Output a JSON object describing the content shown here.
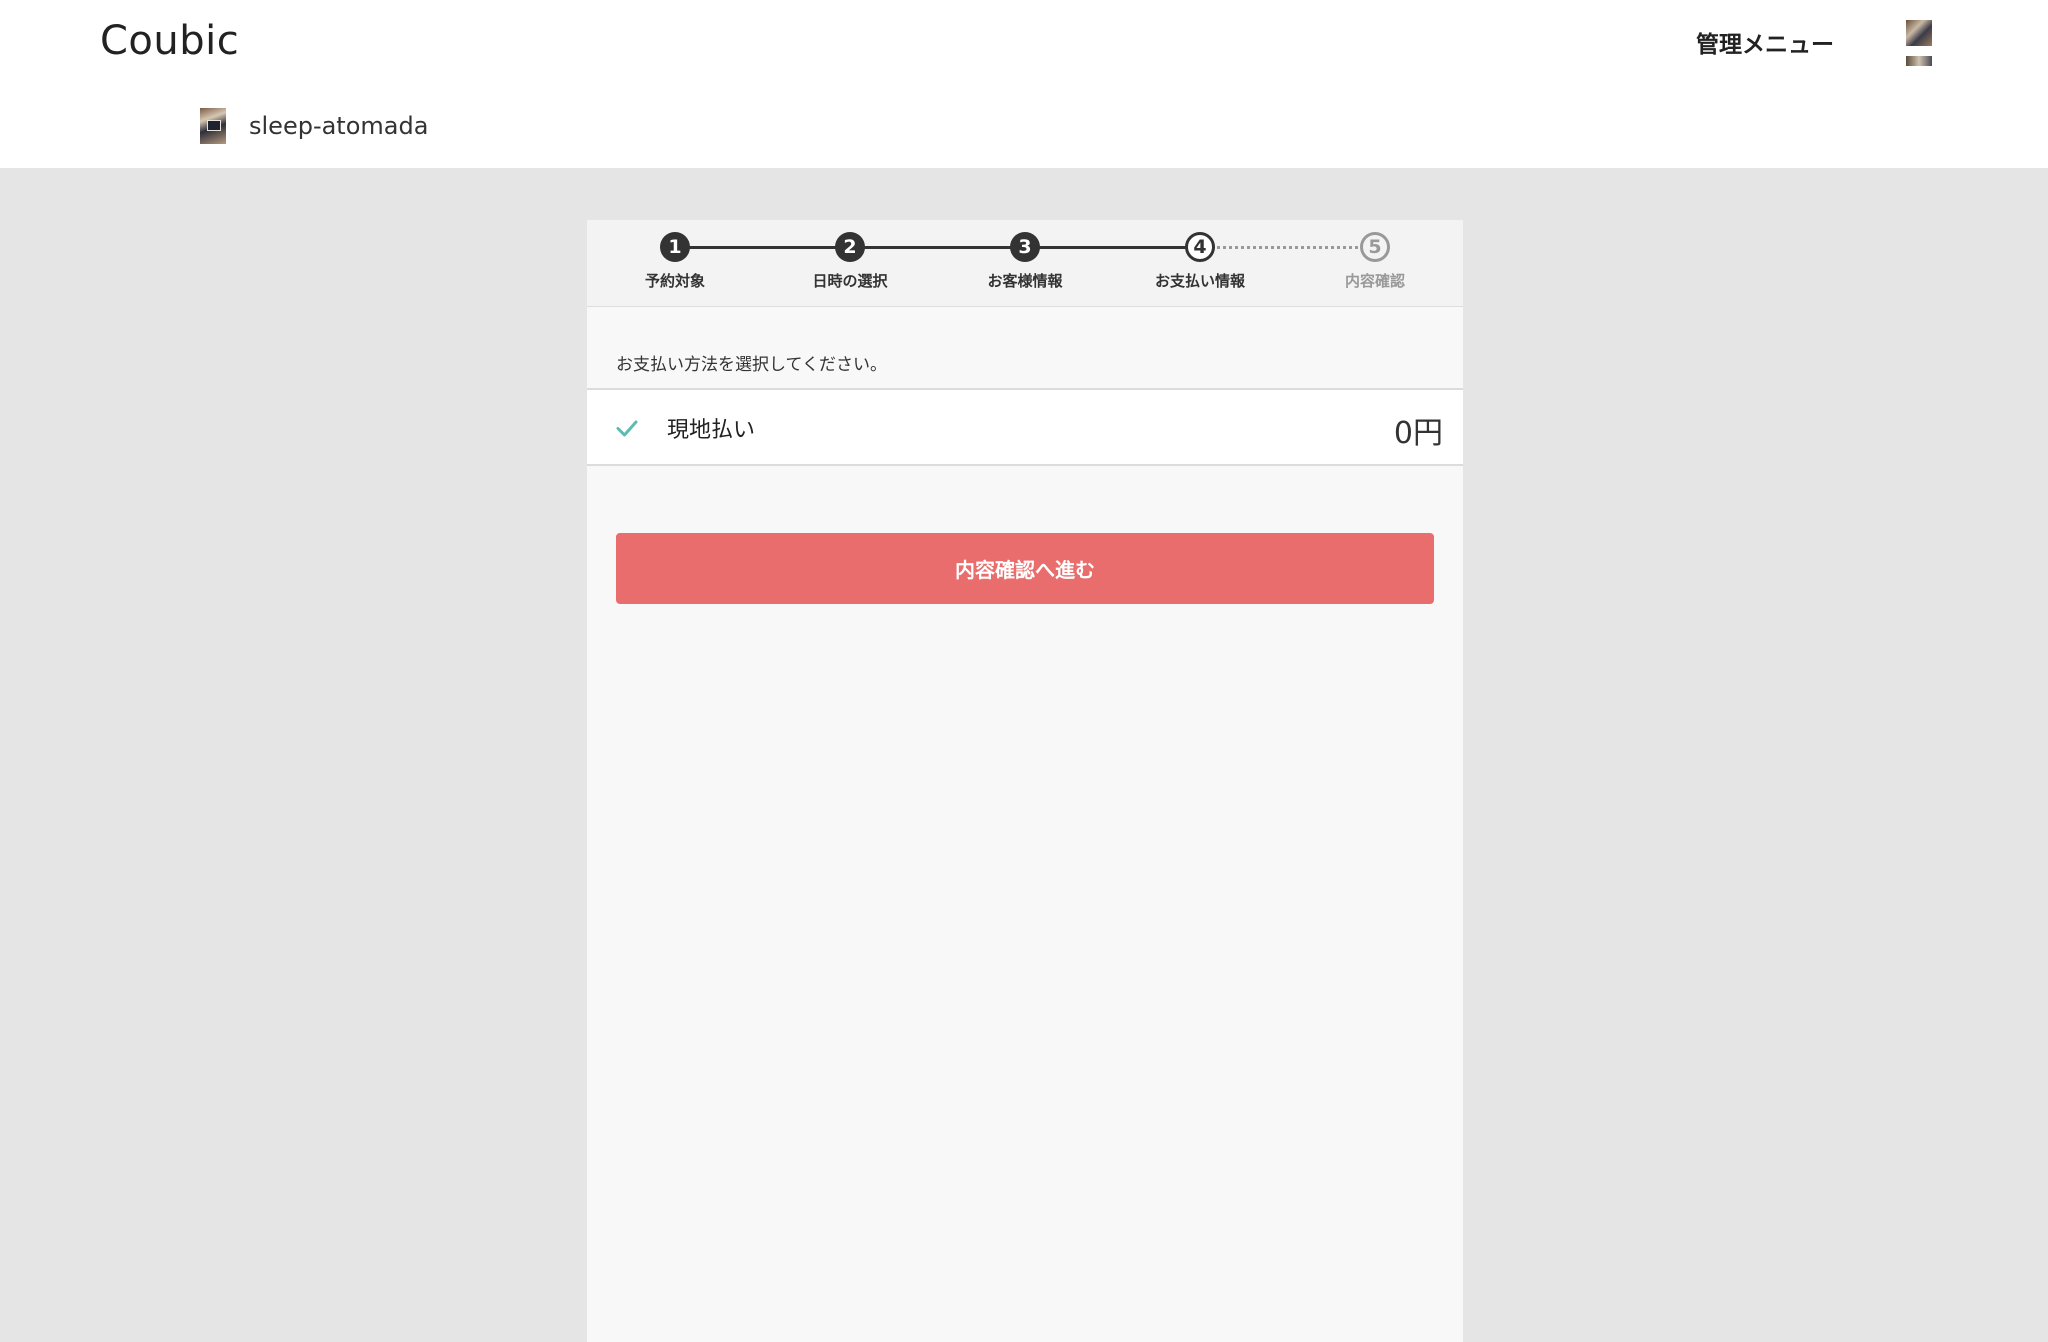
{
  "header": {
    "brand": "Coubic",
    "admin_menu": "管理メニュー",
    "shop_name": "sleep-atomada"
  },
  "steps": [
    {
      "number": "1",
      "label": "予約対象",
      "status": "done"
    },
    {
      "number": "2",
      "label": "日時の選択",
      "status": "done"
    },
    {
      "number": "3",
      "label": "お客様情報",
      "status": "done"
    },
    {
      "number": "4",
      "label": "お支払い情報",
      "status": "current"
    },
    {
      "number": "5",
      "label": "内容確認",
      "status": "todo"
    }
  ],
  "payment": {
    "instruction": "お支払い方法を選択してください。",
    "options": [
      {
        "name": "現地払い",
        "price": "0円",
        "selected": true
      }
    ]
  },
  "proceed_button": "内容確認へ進む",
  "colors": {
    "accent": "#ea6d6d",
    "check": "#5bbcb0",
    "step_done": "#333333",
    "step_todo": "#999999"
  }
}
